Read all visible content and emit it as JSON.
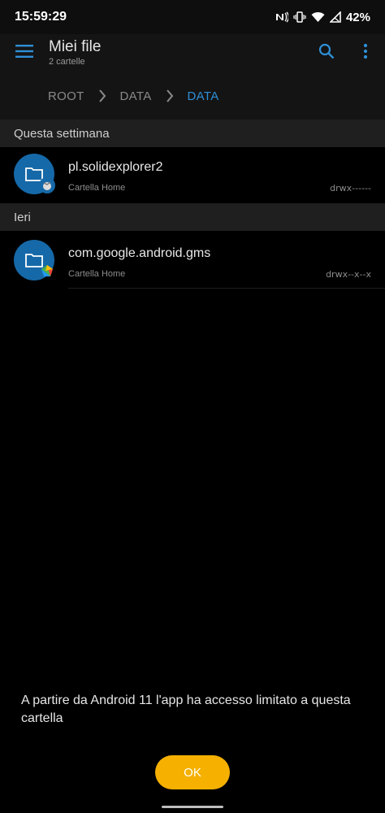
{
  "status_bar": {
    "time": "15:59:29",
    "battery": "42%"
  },
  "app_bar": {
    "title": "Miei file",
    "subtitle": "2 cartelle",
    "accent_color": "#2f8fd6"
  },
  "breadcrumb": {
    "items": [
      "ROOT",
      "DATA",
      "DATA"
    ]
  },
  "sections": [
    {
      "header": "Questa settimana",
      "items": [
        {
          "name": "pl.solidexplorer2",
          "type": "Cartella Home",
          "permissions": "drwx------"
        }
      ]
    },
    {
      "header": "Ieri",
      "items": [
        {
          "name": "com.google.android.gms",
          "type": "Cartella Home",
          "permissions": "drwx--x--x"
        }
      ]
    }
  ],
  "notice": {
    "text": "A partire da Android 11 l'app ha accesso limitato a questa cartella",
    "ok_label": "OK",
    "button_color": "#f5b000"
  }
}
